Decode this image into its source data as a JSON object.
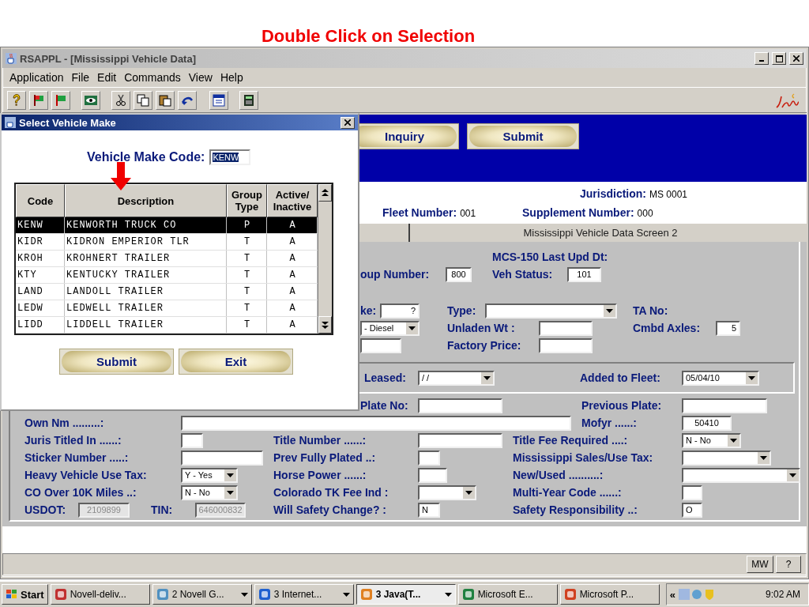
{
  "slide_title": "Double Click on Selection",
  "window": {
    "title": "RSAPPL - [Mississippi Vehicle Data]"
  },
  "menu": [
    "Application",
    "File",
    "Edit",
    "Commands",
    "View",
    "Help"
  ],
  "action_buttons": [
    "Inquiry",
    "Submit"
  ],
  "jurisdiction": {
    "label": "Jurisdiction:",
    "value": "MS  0001"
  },
  "fleet_number": {
    "label": "Fleet Number:",
    "value": "001"
  },
  "supplement_number": {
    "label": "Supplement Number:",
    "value": "000"
  },
  "screen_tab": "Mississippi Vehicle Data Screen 2",
  "form_rows": [
    {
      "kind": "row",
      "items": [
        {
          "kind": "label",
          "text": "MCS-150 Last Upd Dt:"
        }
      ]
    },
    {
      "kind": "row",
      "items": [
        {
          "kind": "label",
          "text": "oup Number:"
        },
        {
          "kind": "input",
          "value": "800"
        },
        {
          "kind": "label",
          "text": "Veh Status:"
        },
        {
          "kind": "input",
          "value": "101"
        }
      ]
    },
    {
      "kind": "row",
      "items": [
        {
          "kind": "label",
          "text": "ke:"
        },
        {
          "kind": "input",
          "value": "?"
        },
        {
          "kind": "label",
          "text": "Type:"
        },
        {
          "kind": "select"
        },
        {
          "kind": "label",
          "text": "TA No:"
        }
      ]
    },
    {
      "kind": "row",
      "items": [
        {
          "kind": "select",
          "value": "- Diesel"
        },
        {
          "kind": "label",
          "text": "Unladen Wt  :"
        },
        {
          "kind": "input"
        },
        {
          "kind": "label",
          "text": "Cmbd Axles:"
        },
        {
          "kind": "input",
          "value": "5"
        }
      ]
    },
    {
      "kind": "row",
      "items": [
        {
          "kind": "input"
        },
        {
          "kind": "label",
          "text": "Factory Price:"
        },
        {
          "kind": "input"
        }
      ]
    },
    {
      "kind": "group",
      "items": [
        {
          "kind": "label",
          "text": "Leased:"
        },
        {
          "kind": "select",
          "value": "/ /"
        },
        {
          "kind": "label",
          "text": "Added to Fleet:"
        },
        {
          "kind": "select",
          "value": "05/04/10"
        }
      ]
    },
    {
      "kind": "row",
      "items": [
        {
          "kind": "label",
          "text": "Plate No:"
        },
        {
          "kind": "input"
        },
        {
          "kind": "label",
          "text": "Previous Plate:"
        },
        {
          "kind": "input"
        }
      ]
    },
    {
      "kind": "row",
      "items": [
        {
          "kind": "label",
          "text": "Own Nm  .........:"
        },
        {
          "kind": "input"
        },
        {
          "kind": "label",
          "text": "Mofyr  ......:"
        },
        {
          "kind": "input",
          "value": "50410"
        }
      ]
    },
    {
      "kind": "row",
      "items": [
        {
          "kind": "label",
          "text": "Juris Titled In  ......:"
        },
        {
          "kind": "input"
        },
        {
          "kind": "label",
          "text": "Title Number  ......:"
        },
        {
          "kind": "input"
        },
        {
          "kind": "label",
          "text": "Title Fee Required  ....:"
        },
        {
          "kind": "select",
          "value": "N - No"
        }
      ]
    },
    {
      "kind": "row",
      "items": [
        {
          "kind": "label",
          "text": "Sticker Number  .....:"
        },
        {
          "kind": "input"
        },
        {
          "kind": "label",
          "text": "Prev Fully Plated  ..:"
        },
        {
          "kind": "input"
        },
        {
          "kind": "label",
          "text": "Mississippi Sales/Use Tax:"
        },
        {
          "kind": "select"
        }
      ]
    },
    {
      "kind": "row",
      "items": [
        {
          "kind": "label",
          "text": "Heavy Vehicle Use Tax:"
        },
        {
          "kind": "select",
          "value": "Y - Yes"
        },
        {
          "kind": "label",
          "text": "Horse Power  ......:"
        },
        {
          "kind": "input"
        },
        {
          "kind": "label",
          "text": "New/Used  ..........:"
        },
        {
          "kind": "select"
        }
      ]
    },
    {
      "kind": "row",
      "items": [
        {
          "kind": "label",
          "text": "CO Over 10K Miles  ..:"
        },
        {
          "kind": "select",
          "value": "N - No"
        },
        {
          "kind": "label",
          "text": "Colorado TK Fee Ind :"
        },
        {
          "kind": "select"
        },
        {
          "kind": "label",
          "text": "Multi-Year Code  ......:"
        },
        {
          "kind": "input"
        }
      ]
    },
    {
      "kind": "row",
      "items": [
        {
          "kind": "label",
          "text": "USDOT:"
        },
        {
          "kind": "readonly",
          "value": "2109899"
        },
        {
          "kind": "label",
          "text": "TIN:"
        },
        {
          "kind": "readonly",
          "value": "646000832"
        },
        {
          "kind": "label",
          "text": "Will Safety Change? :"
        },
        {
          "kind": "input",
          "value": "N"
        },
        {
          "kind": "label",
          "text": "Safety Responsibility  ..:"
        },
        {
          "kind": "input",
          "value": "O"
        }
      ]
    }
  ],
  "status_buttons": [
    "MW",
    "?"
  ],
  "dialog": {
    "title": "Select Vehicle Make",
    "code_label": "Vehicle Make Code:",
    "code_value": "KENW",
    "columns": [
      "Code",
      "Description",
      "Group Type",
      "Active/ Inactive"
    ],
    "rows": [
      {
        "cells": [
          "KENW",
          "KENWORTH TRUCK CO",
          "P",
          "A"
        ],
        "selected": true
      },
      {
        "cells": [
          "KIDR",
          "KIDRON EMPERIOR TLR",
          "T",
          "A"
        ],
        "selected": false
      },
      {
        "cells": [
          "KROH",
          "KROHNERT TRAILER",
          "T",
          "A"
        ],
        "selected": false
      },
      {
        "cells": [
          "KTY",
          "KENTUCKY TRAILER",
          "T",
          "A"
        ],
        "selected": false
      },
      {
        "cells": [
          "LAND",
          "LANDOLL TRAILER",
          "T",
          "A"
        ],
        "selected": false
      },
      {
        "cells": [
          "LEDW",
          "LEDWELL TRAILER",
          "T",
          "A"
        ],
        "selected": false
      },
      {
        "cells": [
          "LIDD",
          "LIDDELL TRAILER",
          "T",
          "A"
        ],
        "selected": false
      }
    ],
    "buttons": [
      "Submit",
      "Exit"
    ]
  },
  "taskbar": {
    "start": "Start",
    "tasks": [
      {
        "label": "Novell-deliv...",
        "selected": false,
        "grouped": false
      },
      {
        "label": "2 Novell G...",
        "selected": false,
        "grouped": true
      },
      {
        "label": "3 Internet...",
        "selected": false,
        "grouped": true
      },
      {
        "label": "3 Java(T...",
        "selected": true,
        "grouped": true
      },
      {
        "label": "Microsoft E...",
        "selected": false,
        "grouped": false
      },
      {
        "label": "Microsoft P...",
        "selected": false,
        "grouped": false
      }
    ],
    "tray_arrow": "«",
    "time": "9:02 AM"
  }
}
